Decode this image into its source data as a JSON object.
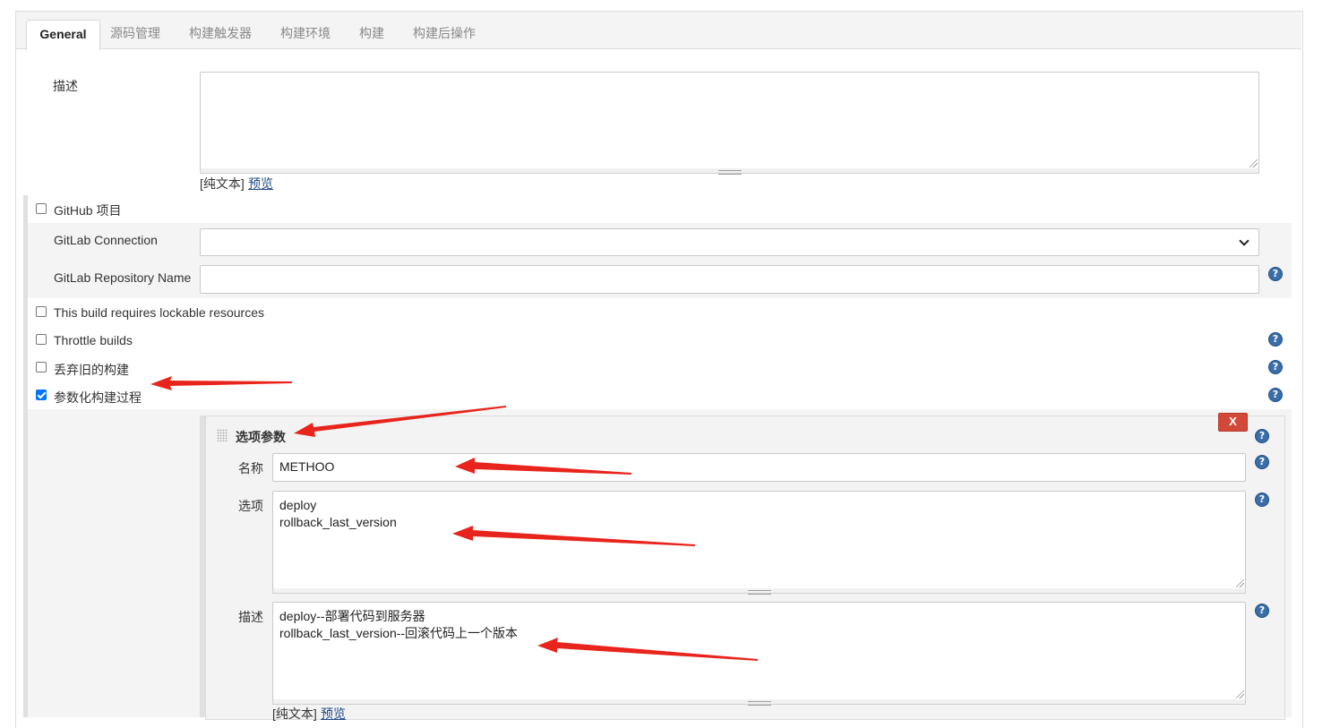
{
  "tabs": [
    {
      "label": "General",
      "active": true
    },
    {
      "label": "源码管理"
    },
    {
      "label": "构建触发器"
    },
    {
      "label": "构建环境"
    },
    {
      "label": "构建"
    },
    {
      "label": "构建后操作"
    }
  ],
  "general": {
    "description_label": "描述",
    "description_value": "",
    "plain_text_label": "[纯文本]",
    "preview_link": "预览",
    "github_project": {
      "label": "GitHub 项目",
      "checked": false
    },
    "gitlab_connection": {
      "label": "GitLab Connection",
      "value": ""
    },
    "gitlab_repository_name": {
      "label": "GitLab Repository Name",
      "value": ""
    },
    "lockable_resources": {
      "label": "This build requires lockable resources",
      "checked": false
    },
    "throttle_builds": {
      "label": "Throttle builds",
      "checked": false
    },
    "discard_old_builds": {
      "label": "丢弃旧的构建",
      "checked": false
    },
    "parameterized": {
      "label": "参数化构建过程",
      "checked": true
    }
  },
  "choice_parameter": {
    "title": "选项参数",
    "delete_label": "X",
    "name_label": "名称",
    "name_value": "METHOO",
    "choices_label": "选项",
    "choices": [
      "deploy",
      "rollback_last_version"
    ],
    "description_label": "描述",
    "description_lines": [
      "deploy--部署代码到服务器",
      "rollback_last_version--回滚代码上一个版本"
    ],
    "plain_text_label": "[纯文本]",
    "preview_link": "预览"
  },
  "help_icon_glyph": "?",
  "annotation_color": "#e8251c",
  "icons": [
    "help-icon",
    "chevron-down-icon",
    "drag-handle-icon",
    "checkbox-icon",
    "resize-grip-icon",
    "annotation-arrow-icon"
  ]
}
